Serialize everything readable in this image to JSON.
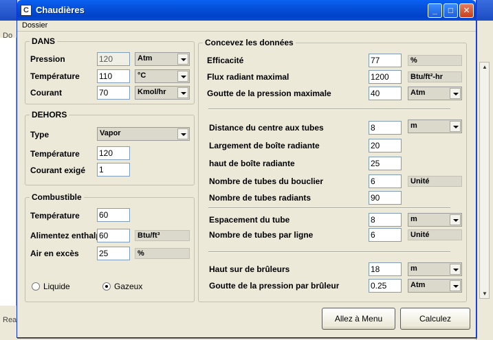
{
  "window": {
    "title": "Chaudières",
    "icon": "app-icon",
    "controls": [
      "minimize",
      "maximize",
      "close"
    ]
  },
  "menu": {
    "dossier": "Dossier"
  },
  "background": {
    "left_text_1": "Do",
    "left_text_2": "Rea"
  },
  "dans": {
    "title": "DANS",
    "pression": {
      "label": "Pression",
      "value": "120",
      "unit": "Atm"
    },
    "temperature": {
      "label": "Température",
      "value": "110",
      "unit": "°C"
    },
    "courant": {
      "label": "Courant",
      "value": "70",
      "unit": "Kmol/hr"
    }
  },
  "dehors": {
    "title": "DEHORS",
    "type": {
      "label": "Type",
      "value": "Vapor"
    },
    "temperature": {
      "label": "Température",
      "value": "120"
    },
    "courant": {
      "label": "Courant exigé",
      "value": "1"
    }
  },
  "combustible": {
    "title": "Combustible",
    "temperature": {
      "label": "Température",
      "value": "60"
    },
    "enthalpie": {
      "label": "Alimentez enthalpie",
      "value": "60",
      "unit": "Btu/ft³"
    },
    "air": {
      "label": "Air en excès",
      "value": "25",
      "unit": "%"
    },
    "radio_liquide": "Liquide",
    "radio_gazeux": "Gazeux",
    "selected": "Gazeux"
  },
  "donnees": {
    "title": "Concevez les données",
    "efficacite": {
      "label": "Efficacité",
      "value": "77",
      "unit": "%"
    },
    "flux": {
      "label": "Flux radiant maximal",
      "value": "1200",
      "unit": "Btu/ft²-hr"
    },
    "goutte": {
      "label": "Goutte de la pression maximale",
      "value": "40",
      "unit": "Atm"
    },
    "distance": {
      "label": "Distance du centre aux tubes",
      "value": "8",
      "unit": "m"
    },
    "largement": {
      "label": "Largement de boîte radiante",
      "value": "20"
    },
    "haut_boite": {
      "label": "haut de boîte radiante",
      "value": "25"
    },
    "tubes_bouclier": {
      "label": "Nombre de tubes du bouclier",
      "value": "6",
      "unit": "Unité"
    },
    "tubes_radiants": {
      "label": "Nombre de tubes radiants",
      "value": "90"
    },
    "espacement": {
      "label": "Espacement du tube",
      "value": "8",
      "unit": "m"
    },
    "tubes_ligne": {
      "label": "Nombre de tubes par ligne",
      "value": "6",
      "unit": "Unité"
    },
    "haut_bruleurs": {
      "label": "Haut sur de brûleurs",
      "value": "18",
      "unit": "m"
    },
    "goutte_bruleur": {
      "label": "Goutte de la pression par brûleur",
      "value": "0.25",
      "unit": "Atm"
    }
  },
  "buttons": {
    "menu": "Allez à Menu",
    "calc": "Calculez"
  }
}
